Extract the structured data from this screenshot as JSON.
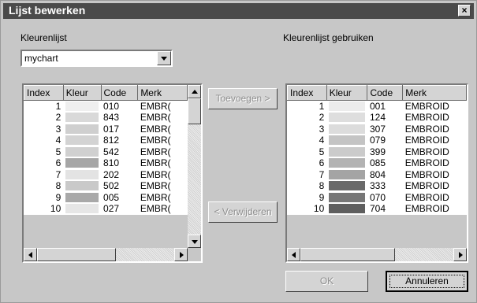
{
  "dialog": {
    "title": "Lijst bewerken",
    "close_glyph": "×"
  },
  "left": {
    "label": "Kleurenlijst",
    "combo_value": "mychart",
    "columns": [
      "Index",
      "Kleur",
      "Code",
      "Merk"
    ],
    "rows": [
      {
        "index": "1",
        "color": "#efefef",
        "code": "010",
        "brand": "EMBR("
      },
      {
        "index": "2",
        "color": "#d9d9d9",
        "code": "843",
        "brand": "EMBR("
      },
      {
        "index": "3",
        "color": "#cfcfcf",
        "code": "017",
        "brand": "EMBR("
      },
      {
        "index": "4",
        "color": "#d3d3d3",
        "code": "812",
        "brand": "EMBR("
      },
      {
        "index": "5",
        "color": "#d0d0d0",
        "code": "542",
        "brand": "EMBR("
      },
      {
        "index": "6",
        "color": "#a6a6a6",
        "code": "810",
        "brand": "EMBR("
      },
      {
        "index": "7",
        "color": "#e3e3e3",
        "code": "202",
        "brand": "EMBR("
      },
      {
        "index": "8",
        "color": "#c9c9c9",
        "code": "502",
        "brand": "EMBR("
      },
      {
        "index": "9",
        "color": "#a9a9a9",
        "code": "005",
        "brand": "EMBR("
      },
      {
        "index": "10",
        "color": "#e6e6e6",
        "code": "027",
        "brand": "EMBR("
      }
    ]
  },
  "right": {
    "label": "Kleurenlijst gebruiken",
    "columns": [
      "Index",
      "Kleur",
      "Code",
      "Merk"
    ],
    "rows": [
      {
        "index": "1",
        "color": "#ececec",
        "code": "001",
        "brand": "EMBROID"
      },
      {
        "index": "2",
        "color": "#dedede",
        "code": "124",
        "brand": "EMBROID"
      },
      {
        "index": "3",
        "color": "#dcdcdc",
        "code": "307",
        "brand": "EMBROID"
      },
      {
        "index": "4",
        "color": "#c4c4c4",
        "code": "079",
        "brand": "EMBROID"
      },
      {
        "index": "5",
        "color": "#cbcbcb",
        "code": "399",
        "brand": "EMBROID"
      },
      {
        "index": "6",
        "color": "#b3b3b3",
        "code": "085",
        "brand": "EMBROID"
      },
      {
        "index": "7",
        "color": "#a4a4a4",
        "code": "804",
        "brand": "EMBROID"
      },
      {
        "index": "8",
        "color": "#6a6a6a",
        "code": "333",
        "brand": "EMBROID"
      },
      {
        "index": "9",
        "color": "#767676",
        "code": "070",
        "brand": "EMBROID"
      },
      {
        "index": "10",
        "color": "#5e5e5e",
        "code": "704",
        "brand": "EMBROID"
      }
    ]
  },
  "buttons": {
    "add": "Toevoegen >",
    "remove": "< Verwijderen",
    "ok": "OK",
    "cancel": "Annuleren"
  }
}
